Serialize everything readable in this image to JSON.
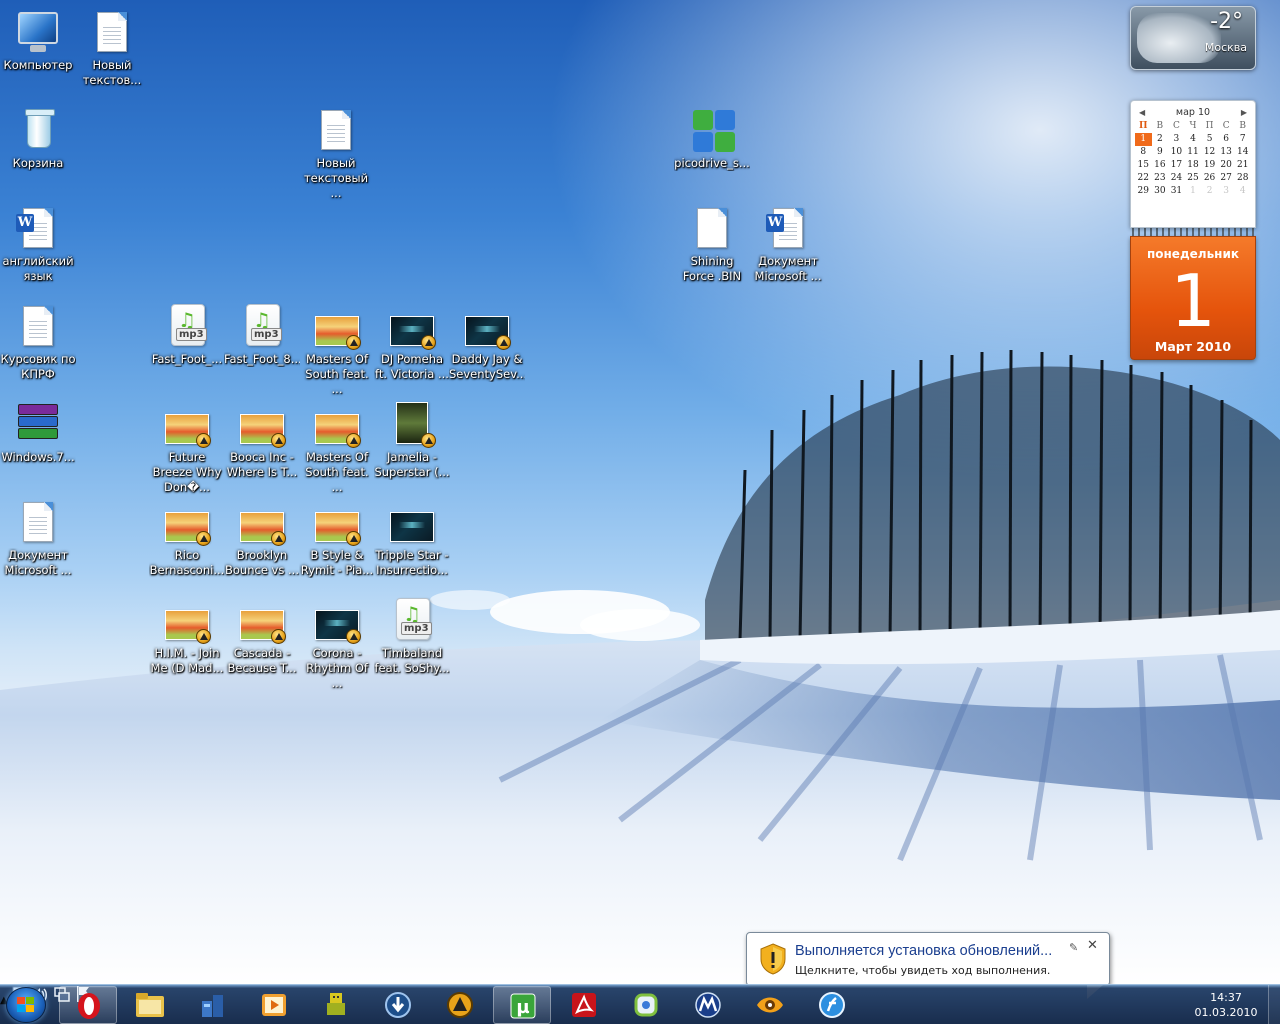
{
  "desktop": {
    "icons": [
      {
        "id": "computer",
        "label": "Компьютер"
      },
      {
        "id": "new-text-1",
        "label": "Новый текстов..."
      },
      {
        "id": "recycle-bin",
        "label": "Корзина"
      },
      {
        "id": "new-text-2",
        "label": "Новый текстовый ..."
      },
      {
        "id": "picodrive",
        "label": "picodrive_s..."
      },
      {
        "id": "english",
        "label": "английский язык"
      },
      {
        "id": "shining-force",
        "label": "Shining Force .BIN"
      },
      {
        "id": "doc-ms-1",
        "label": "Документ Microsoft ..."
      },
      {
        "id": "kursovik",
        "label": "Курсовик по КПРФ"
      },
      {
        "id": "fast-foot-1",
        "label": "Fast_Foot_..."
      },
      {
        "id": "fast-foot-2",
        "label": "Fast_Foot_8..."
      },
      {
        "id": "masters-1",
        "label": "Masters Of South feat. ..."
      },
      {
        "id": "dj-pomeha",
        "label": "DJ Pomeha ft. Victoria ..."
      },
      {
        "id": "daddy-jay",
        "label": "Daddy Jay & SeventySev..."
      },
      {
        "id": "windows7",
        "label": "Windows.7..."
      },
      {
        "id": "future-breeze",
        "label": "Future Breeze Why Don�..."
      },
      {
        "id": "booca",
        "label": "Booca Inc - Where Is T..."
      },
      {
        "id": "masters-2",
        "label": "Masters Of South feat. ..."
      },
      {
        "id": "jamelia",
        "label": "Jamelia - Superstar (..."
      },
      {
        "id": "doc-ms-2",
        "label": "Документ Microsoft ..."
      },
      {
        "id": "rico",
        "label": "Rico Bernasconi..."
      },
      {
        "id": "brooklyn",
        "label": "Brooklyn Bounce vs ..."
      },
      {
        "id": "bstyle",
        "label": "B Style & Rymit - Pia..."
      },
      {
        "id": "tripple",
        "label": "Tripple Star - Insurrectio..."
      },
      {
        "id": "him",
        "label": "H.I.M. - Join Me (D Mad..."
      },
      {
        "id": "cascada",
        "label": "Cascada - Because T..."
      },
      {
        "id": "corona",
        "label": "Corona - Rhythm Of ..."
      },
      {
        "id": "timbaland",
        "label": "Timbaland feat. SoShy..."
      }
    ]
  },
  "gadgets": {
    "weather": {
      "temperature": "-2°",
      "city": "Москва"
    },
    "calendar": {
      "month_header": "мар 10",
      "weekdays": [
        "П",
        "В",
        "С",
        "Ч",
        "П",
        "С",
        "В"
      ],
      "weeks": [
        [
          "1",
          "2",
          "3",
          "4",
          "5",
          "6",
          "7"
        ],
        [
          "8",
          "9",
          "10",
          "11",
          "12",
          "13",
          "14"
        ],
        [
          "15",
          "16",
          "17",
          "18",
          "19",
          "20",
          "21"
        ],
        [
          "22",
          "23",
          "24",
          "25",
          "26",
          "27",
          "28"
        ],
        [
          "29",
          "30",
          "31",
          "1",
          "2",
          "3",
          "4"
        ]
      ],
      "today": "1",
      "day_of_week": "понедельник",
      "day_number": "1",
      "month_year": "Март 2010"
    }
  },
  "notification": {
    "title": "Выполняется установка обновлений...",
    "message": "Щелкните, чтобы увидеть ход выполнения."
  },
  "taskbar": {
    "pinned": [
      "opera",
      "windows-explorer",
      "network",
      "media-player",
      "game-pad",
      "download-manager",
      "aimp",
      "utorrent",
      "acrobat-reader",
      "app",
      "motorola",
      "xnview",
      "firefox-like"
    ],
    "tray": {
      "time": "14:37",
      "date": "01.03.2010"
    }
  },
  "colors": {
    "taskbar": "#16284a",
    "calendar_accent": "#e5540c",
    "wallpaper_sky": "#3b82d4"
  }
}
